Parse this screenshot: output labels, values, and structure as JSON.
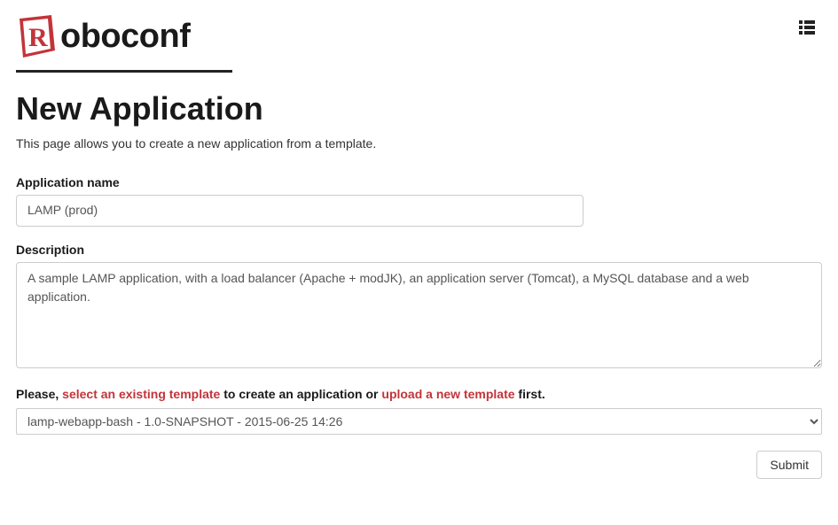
{
  "brand": {
    "logo_text": "oboconf"
  },
  "page": {
    "title": "New Application",
    "intro": "This page allows you to create a new application from a template."
  },
  "form": {
    "app_name": {
      "label": "Application name",
      "value": "LAMP (prod)"
    },
    "description": {
      "label": "Description",
      "value": "A sample LAMP application, with a load balancer (Apache + modJK), an application server (Tomcat), a MySQL database and a web application."
    },
    "template_prompt": {
      "prefix": "Please, ",
      "link_existing": "select an existing template",
      "middle": " to create an application or ",
      "link_upload": "upload a new template",
      "suffix": " first."
    },
    "template_select": {
      "selected": "lamp-webapp-bash - 1.0-SNAPSHOT - 2015-06-25 14:26"
    },
    "submit_label": "Submit"
  }
}
